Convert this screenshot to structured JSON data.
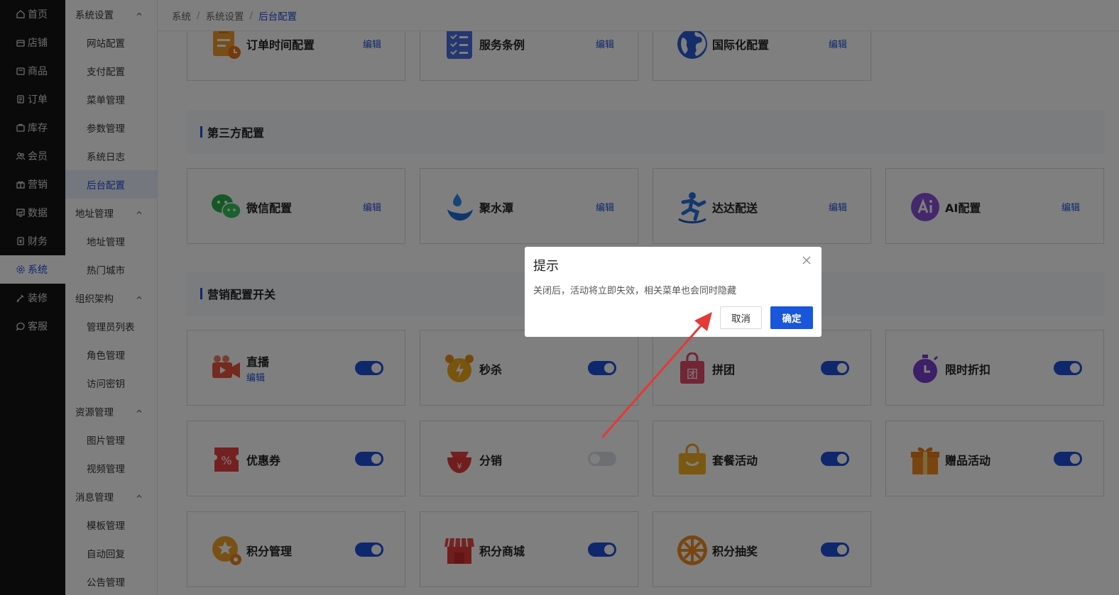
{
  "nav_primary": [
    {
      "label": "首页",
      "icon": "home-icon"
    },
    {
      "label": "店铺",
      "icon": "store-icon"
    },
    {
      "label": "商品",
      "icon": "goods-icon"
    },
    {
      "label": "订单",
      "icon": "order-icon"
    },
    {
      "label": "库存",
      "icon": "inventory-icon"
    },
    {
      "label": "会员",
      "icon": "members-icon"
    },
    {
      "label": "营销",
      "icon": "gift-icon"
    },
    {
      "label": "数据",
      "icon": "data-icon"
    },
    {
      "label": "财务",
      "icon": "finance-icon"
    },
    {
      "label": "系统",
      "icon": "gear-icon",
      "active": true
    },
    {
      "label": "装修",
      "icon": "decorate-icon"
    },
    {
      "label": "客服",
      "icon": "chat-icon"
    }
  ],
  "nav_secondary": {
    "g1": "系统设置",
    "g1_items": [
      "网站配置",
      "支付配置",
      "菜单管理",
      "参数管理",
      "系统日志",
      "后台配置"
    ],
    "g2": "地址管理",
    "g2_items": [
      "地址管理",
      "热门城市"
    ],
    "g3": "组织架构",
    "g3_items": [
      "管理员列表",
      "角色管理",
      "访问密钥"
    ],
    "g4": "资源管理",
    "g4_items": [
      "图片管理",
      "视频管理"
    ],
    "g5": "消息管理",
    "g5_items": [
      "模板管理",
      "自动回复",
      "公告管理"
    ]
  },
  "breadcrumb": [
    "系统",
    "系统设置",
    "后台配置"
  ],
  "edit_label": "编辑",
  "top_cards": [
    "订单时间配置",
    "服务条例",
    "国际化配置"
  ],
  "section_third": "第三方配置",
  "third_cards": [
    "微信配置",
    "聚水潭",
    "达达配送",
    "AI配置"
  ],
  "section_marketing": "营销配置开关",
  "marketing_cards": [
    {
      "label": "直播",
      "on": true,
      "sub": "编辑"
    },
    {
      "label": "秒杀",
      "on": true
    },
    {
      "label": "拼团",
      "on": true
    },
    {
      "label": "限时折扣",
      "on": true
    },
    {
      "label": "优惠券",
      "on": true
    },
    {
      "label": "分销",
      "on": false
    },
    {
      "label": "套餐活动",
      "on": true
    },
    {
      "label": "赠品活动",
      "on": true
    },
    {
      "label": "积分管理",
      "on": true
    },
    {
      "label": "积分商城",
      "on": true
    },
    {
      "label": "积分抽奖",
      "on": true
    }
  ],
  "dialog": {
    "title": "提示",
    "message": "关闭后，活动将立即失效，相关菜单也会同时隐藏",
    "cancel": "取消",
    "confirm": "确定"
  },
  "colors": {
    "accent": "#1f4fd8",
    "nav_bg": "#141414",
    "annotation_arrow": "#e53935"
  }
}
